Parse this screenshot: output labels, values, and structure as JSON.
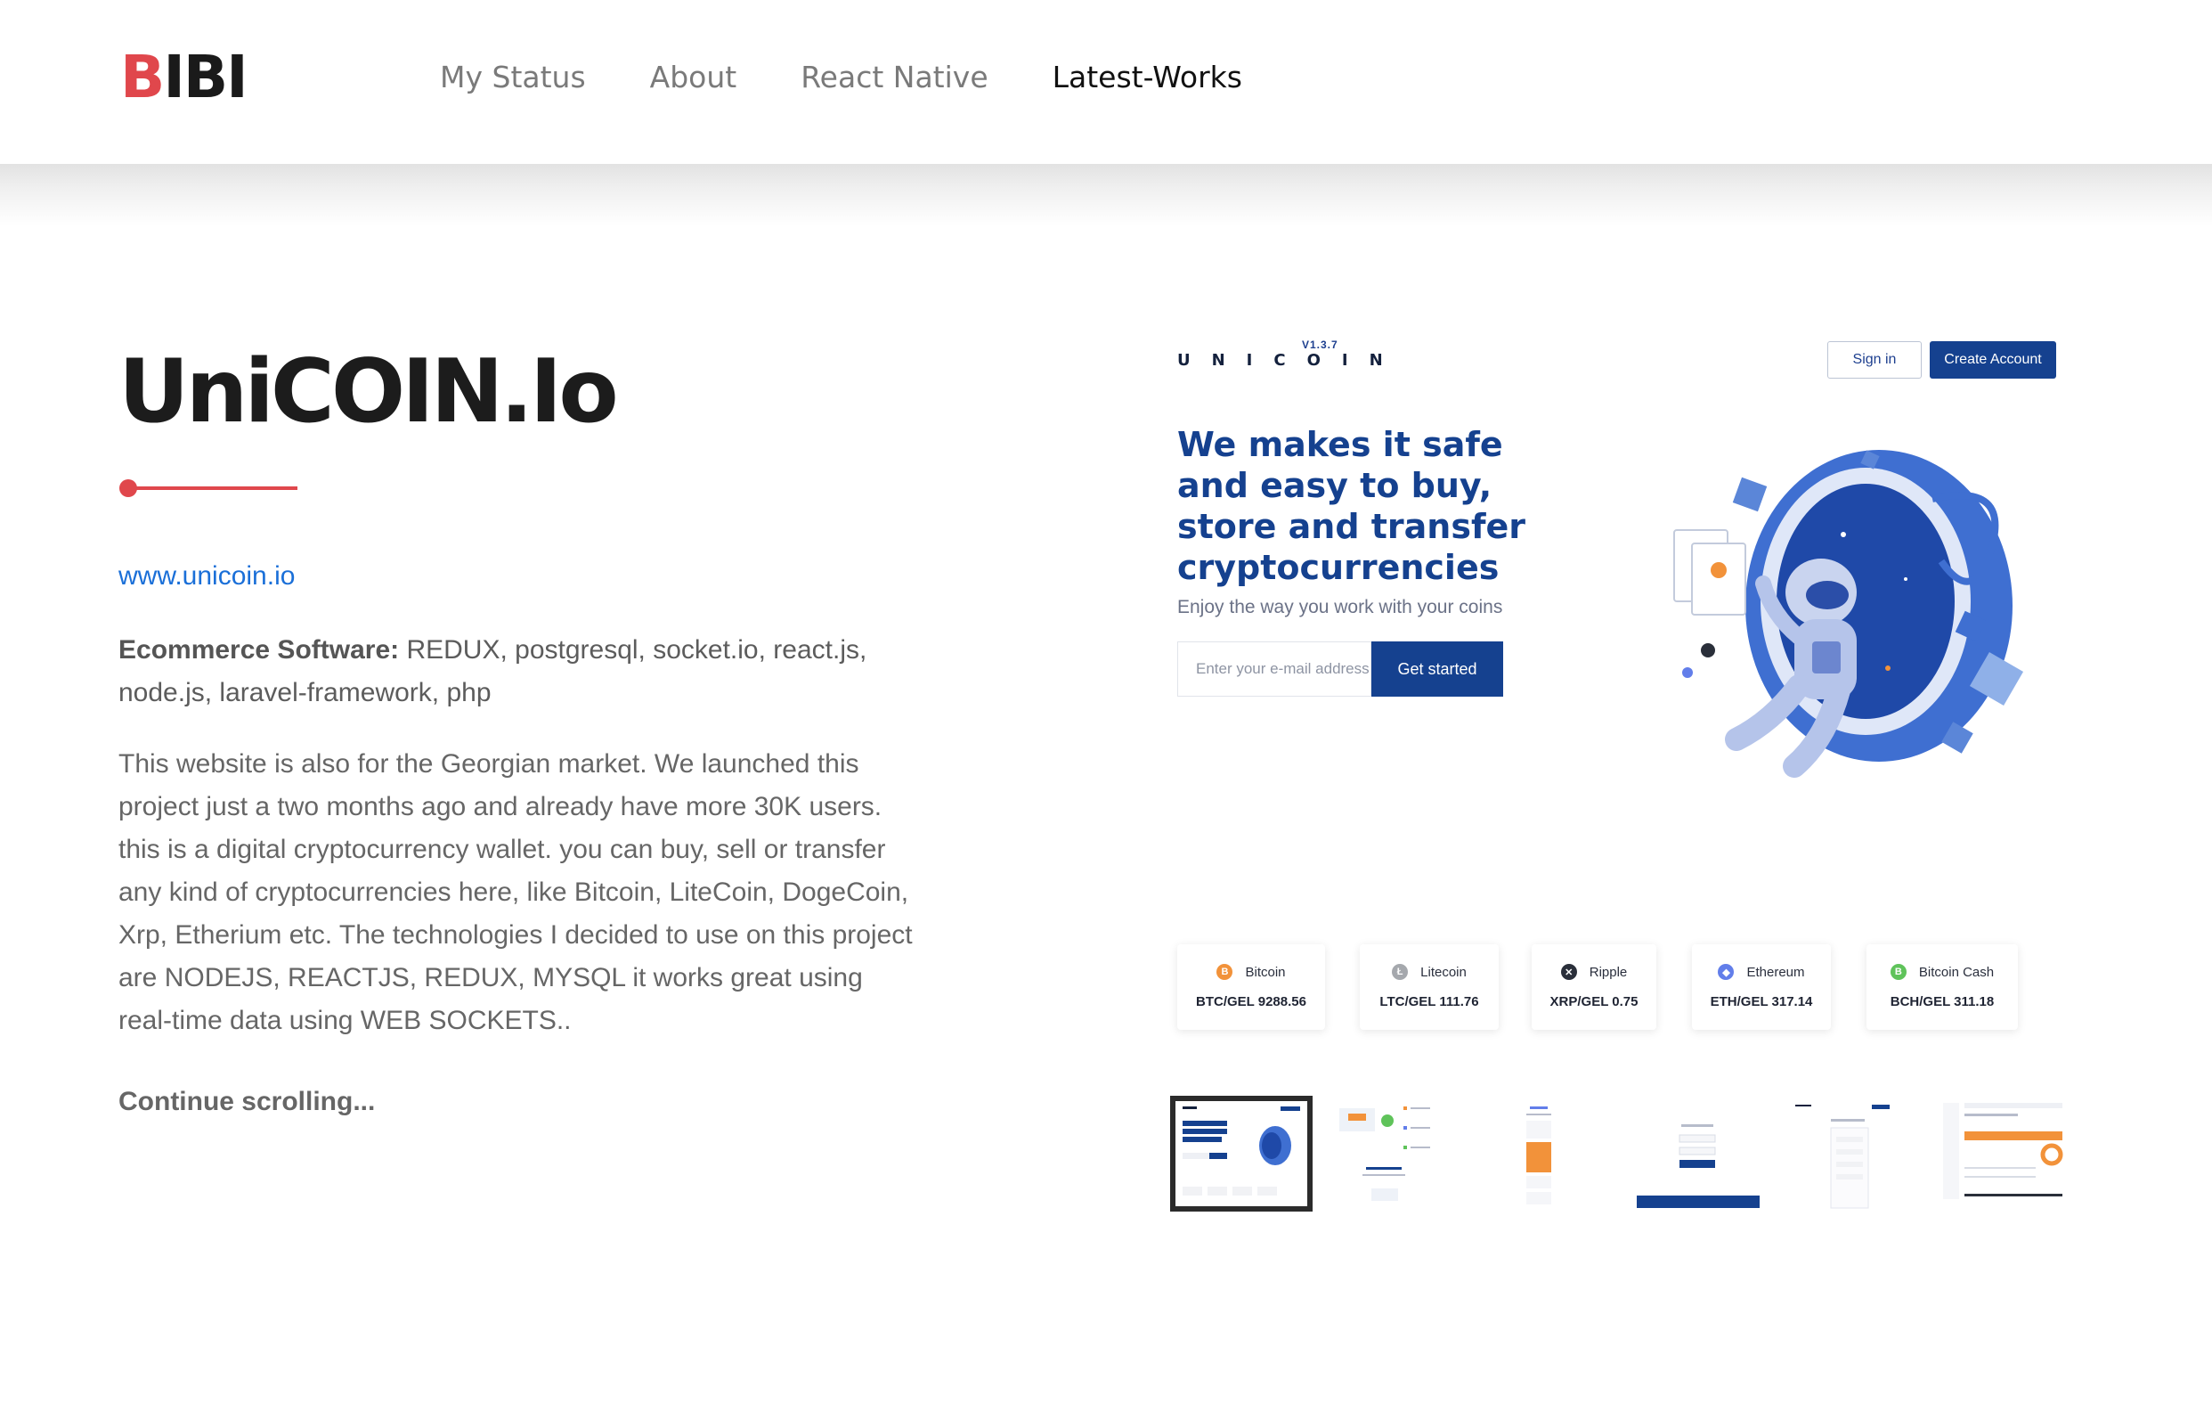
{
  "header": {
    "logo_accent": "B",
    "logo_rest": "IBI",
    "nav": [
      {
        "label": "My Status"
      },
      {
        "label": "About"
      },
      {
        "label": "React Native"
      },
      {
        "label": "Latest-Works"
      }
    ]
  },
  "project": {
    "title": "UniCOIN.Io",
    "link": "www.unicoin.io",
    "tech_label": "Ecommerce Software:",
    "tech_list": " REDUX, postgresql, socket.io, react.js, node.js, laravel-framework, php",
    "description": "This website is also for the Georgian market. We launched this project just a two months ago and already have more 30K users. this is a digital cryptocurrency wallet. you can buy, sell or transfer any kind of cryptocurrencies here, like Bitcoin, LiteCoin, DogeCoin, Xrp, Etherium etc. The technologies I decided to use on this project are NODEJS, REACTJS, REDUX, MYSQL it works great using real-time data using WEB SOCKETS..",
    "continue": "Continue scrolling..."
  },
  "preview": {
    "brand": "UNICOIN",
    "version": "V1.3.7",
    "signin": "Sign in",
    "create_account": "Create Account",
    "hero_title": "We makes it safe and easy to buy, store and transfer cryptocurrencies",
    "hero_sub": "Enjoy the way you work with your coins",
    "email_placeholder": "Enter your e-mail address",
    "get_started": "Get started",
    "coins": [
      {
        "name": "Bitcoin",
        "rate": "BTC/GEL 9288.56",
        "color": "#f2923a",
        "icon": "bitcoin-icon",
        "glyph": "B"
      },
      {
        "name": "Litecoin",
        "rate": "LTC/GEL 111.76",
        "color": "#a5a8ad",
        "icon": "litecoin-icon",
        "glyph": "Ł"
      },
      {
        "name": "Ripple",
        "rate": "XRP/GEL 0.75",
        "color": "#2a2f3a",
        "icon": "ripple-icon",
        "glyph": "✕"
      },
      {
        "name": "Ethereum",
        "rate": "ETH/GEL 317.14",
        "color": "#627eea",
        "icon": "ethereum-icon",
        "glyph": "◆"
      },
      {
        "name": "Bitcoin Cash",
        "rate": "BCH/GEL 311.18",
        "color": "#5fc35a",
        "icon": "bitcoin-cash-icon",
        "glyph": "B"
      }
    ]
  },
  "colors": {
    "accent": "#e0474c",
    "brand_blue": "#15418f",
    "link": "#1a6fd8"
  }
}
